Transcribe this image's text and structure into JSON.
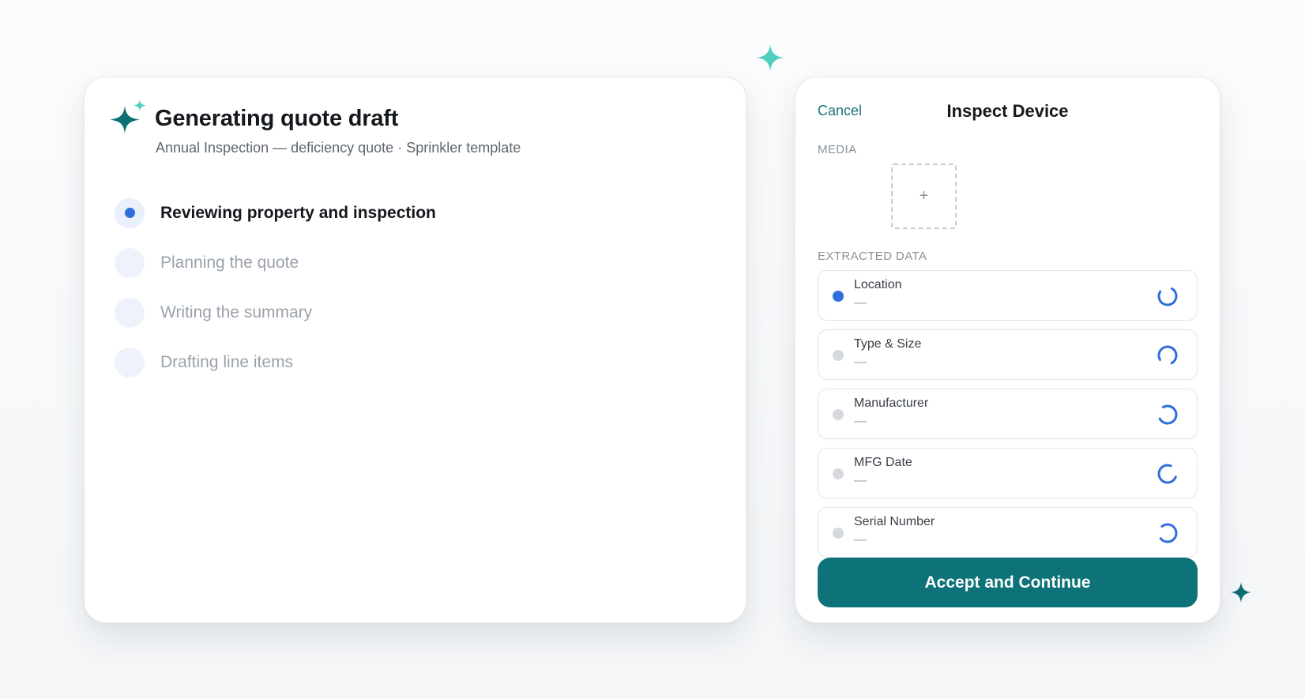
{
  "colors": {
    "accent_teal": "#0d7378",
    "sparkle_light": "#4fcfbe",
    "sparkle_dark": "#0c6f73",
    "active_blue": "#2f6fdb",
    "muted_text": "#9aa2ab"
  },
  "quote_panel": {
    "icon": "sparkles-icon",
    "title": "Generating quote draft",
    "subtitle": "Annual Inspection — deficiency quote · Sprinkler template",
    "steps": [
      {
        "label": "Reviewing property and inspection",
        "state": "active"
      },
      {
        "label": "Planning the quote",
        "state": "pending"
      },
      {
        "label": "Writing the summary",
        "state": "pending"
      },
      {
        "label": "Drafting line items",
        "state": "pending"
      }
    ]
  },
  "inspect_panel": {
    "cancel_label": "Cancel",
    "title": "Inspect Device",
    "media_label": "MEDIA",
    "media_add_symbol": "+",
    "extracted_label": "EXTRACTED DATA",
    "fields": [
      {
        "label": "Location",
        "value": "—",
        "state": "active",
        "icon": "loading-spinner-icon"
      },
      {
        "label": "Type & Size",
        "value": "—",
        "state": "pending",
        "icon": "loading-spinner-icon"
      },
      {
        "label": "Manufacturer",
        "value": "—",
        "state": "pending",
        "icon": "loading-spinner-icon"
      },
      {
        "label": "MFG Date",
        "value": "—",
        "state": "pending",
        "icon": "loading-spinner-icon"
      },
      {
        "label": "Serial Number",
        "value": "—",
        "state": "pending",
        "icon": "loading-spinner-icon"
      }
    ],
    "accept_label": "Accept and Continue"
  }
}
